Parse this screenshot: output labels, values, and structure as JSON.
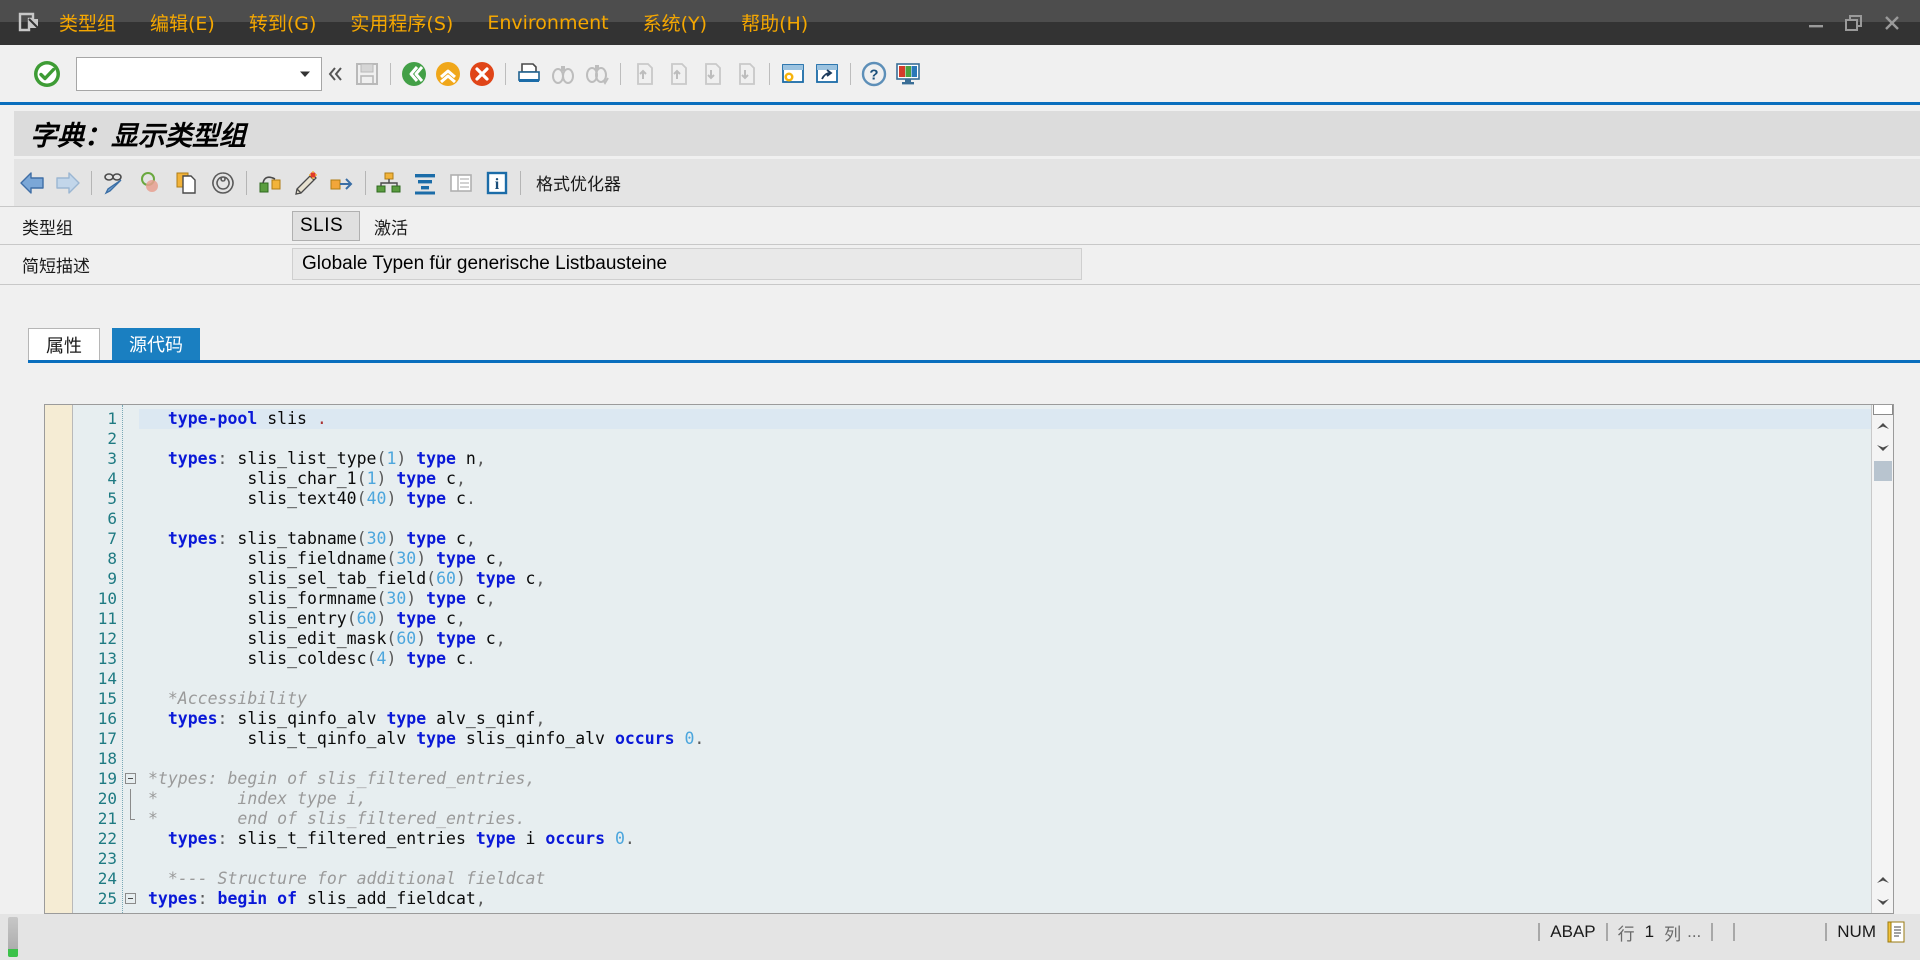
{
  "window": {
    "system_icon": "sap-logo-icon",
    "controls": {
      "minimize": "minimize-icon",
      "restore": "restore-icon",
      "close": "close-icon"
    }
  },
  "menubar": {
    "items": [
      {
        "label": "类型组",
        "accel": ""
      },
      {
        "label": "编辑(E)",
        "accel": "E"
      },
      {
        "label": "转到(G)",
        "accel": "G"
      },
      {
        "label": "实用程序(S)",
        "accel": "S"
      },
      {
        "label": "Environment",
        "accel": ""
      },
      {
        "label": "系统(Y)",
        "accel": "Y"
      },
      {
        "label": "帮助(H)",
        "accel": "H"
      }
    ]
  },
  "toolbar": {
    "ok_button": "green-check-icon",
    "command_value": "",
    "command_placeholder": "",
    "dropdown": "chevron-down-icon",
    "collapse": "double-chevron-left-icon",
    "icons": [
      "save-icon",
      "back-green-icon",
      "exit-yellow-icon",
      "cancel-red-icon",
      "print-icon",
      "find-icon",
      "find-next-icon",
      "first-page-icon",
      "previous-page-icon",
      "next-page-icon",
      "last-page-icon",
      "create-session-icon",
      "create-shortcut-icon",
      "help-icon",
      "customize-layout-icon"
    ]
  },
  "page": {
    "title": "字典：显示类型组"
  },
  "apptoolbar": {
    "icons": [
      "back-arrow-icon",
      "forward-arrow-icon",
      "display-change-icon",
      "check-icon",
      "copy-icon",
      "where-used-icon",
      "activate-icon",
      "pretty-printer-icon",
      "generate-icon",
      "hierarchy-icon",
      "sort-icon",
      "list-icon",
      "info-icon"
    ],
    "format_button": "格式优化器"
  },
  "form": {
    "rows": [
      {
        "label": "类型组",
        "value": "SLIS",
        "status": "激活",
        "kind": "small"
      },
      {
        "label": "简短描述",
        "value": "Globale Typen für generische Listbausteine",
        "status": "",
        "kind": "wide"
      }
    ]
  },
  "tabs": [
    {
      "label": "属性",
      "active": false
    },
    {
      "label": "源代码",
      "active": true
    }
  ],
  "editor": {
    "language": "ABAP",
    "current_line": 1,
    "lines": [
      {
        "n": 1,
        "fold": "none",
        "cur": true,
        "tokens": [
          [
            "ws",
            "  "
          ],
          [
            "kw",
            "type-pool"
          ],
          [
            "id",
            " slis "
          ],
          [
            "dot",
            "."
          ]
        ]
      },
      {
        "n": 2,
        "fold": "none",
        "cur": false,
        "tokens": []
      },
      {
        "n": 3,
        "fold": "none",
        "cur": false,
        "tokens": [
          [
            "ws",
            "  "
          ],
          [
            "kw",
            "types"
          ],
          [
            "punct",
            ": "
          ],
          [
            "id",
            "slis_list_type"
          ],
          [
            "punct",
            "("
          ],
          [
            "num",
            "1"
          ],
          [
            "punct",
            ") "
          ],
          [
            "kw",
            "type"
          ],
          [
            "id",
            " n"
          ],
          [
            "punct",
            ","
          ]
        ]
      },
      {
        "n": 4,
        "fold": "none",
        "cur": false,
        "tokens": [
          [
            "ws",
            "          "
          ],
          [
            "id",
            "slis_char_1"
          ],
          [
            "punct",
            "("
          ],
          [
            "num",
            "1"
          ],
          [
            "punct",
            ") "
          ],
          [
            "kw",
            "type"
          ],
          [
            "id",
            " c"
          ],
          [
            "punct",
            ","
          ]
        ]
      },
      {
        "n": 5,
        "fold": "none",
        "cur": false,
        "tokens": [
          [
            "ws",
            "          "
          ],
          [
            "id",
            "slis_text40"
          ],
          [
            "punct",
            "("
          ],
          [
            "num",
            "40"
          ],
          [
            "punct",
            ") "
          ],
          [
            "kw",
            "type"
          ],
          [
            "id",
            " c"
          ],
          [
            "punct",
            "."
          ]
        ]
      },
      {
        "n": 6,
        "fold": "none",
        "cur": false,
        "tokens": []
      },
      {
        "n": 7,
        "fold": "none",
        "cur": false,
        "tokens": [
          [
            "ws",
            "  "
          ],
          [
            "kw",
            "types"
          ],
          [
            "punct",
            ": "
          ],
          [
            "id",
            "slis_tabname"
          ],
          [
            "punct",
            "("
          ],
          [
            "num",
            "30"
          ],
          [
            "punct",
            ") "
          ],
          [
            "kw",
            "type"
          ],
          [
            "id",
            " c"
          ],
          [
            "punct",
            ","
          ]
        ]
      },
      {
        "n": 8,
        "fold": "none",
        "cur": false,
        "tokens": [
          [
            "ws",
            "          "
          ],
          [
            "id",
            "slis_fieldname"
          ],
          [
            "punct",
            "("
          ],
          [
            "num",
            "30"
          ],
          [
            "punct",
            ") "
          ],
          [
            "kw",
            "type"
          ],
          [
            "id",
            " c"
          ],
          [
            "punct",
            ","
          ]
        ]
      },
      {
        "n": 9,
        "fold": "none",
        "cur": false,
        "tokens": [
          [
            "ws",
            "          "
          ],
          [
            "id",
            "slis_sel_tab_field"
          ],
          [
            "punct",
            "("
          ],
          [
            "num",
            "60"
          ],
          [
            "punct",
            ") "
          ],
          [
            "kw",
            "type"
          ],
          [
            "id",
            " c"
          ],
          [
            "punct",
            ","
          ]
        ]
      },
      {
        "n": 10,
        "fold": "none",
        "cur": false,
        "tokens": [
          [
            "ws",
            "          "
          ],
          [
            "id",
            "slis_formname"
          ],
          [
            "punct",
            "("
          ],
          [
            "num",
            "30"
          ],
          [
            "punct",
            ") "
          ],
          [
            "kw",
            "type"
          ],
          [
            "id",
            " c"
          ],
          [
            "punct",
            ","
          ]
        ]
      },
      {
        "n": 11,
        "fold": "none",
        "cur": false,
        "tokens": [
          [
            "ws",
            "          "
          ],
          [
            "id",
            "slis_entry"
          ],
          [
            "punct",
            "("
          ],
          [
            "num",
            "60"
          ],
          [
            "punct",
            ") "
          ],
          [
            "kw",
            "type"
          ],
          [
            "id",
            " c"
          ],
          [
            "punct",
            ","
          ]
        ]
      },
      {
        "n": 12,
        "fold": "none",
        "cur": false,
        "tokens": [
          [
            "ws",
            "          "
          ],
          [
            "id",
            "slis_edit_mask"
          ],
          [
            "punct",
            "("
          ],
          [
            "num",
            "60"
          ],
          [
            "punct",
            ") "
          ],
          [
            "kw",
            "type"
          ],
          [
            "id",
            " c"
          ],
          [
            "punct",
            ","
          ]
        ]
      },
      {
        "n": 13,
        "fold": "none",
        "cur": false,
        "tokens": [
          [
            "ws",
            "          "
          ],
          [
            "id",
            "slis_coldesc"
          ],
          [
            "punct",
            "("
          ],
          [
            "num",
            "4"
          ],
          [
            "punct",
            ") "
          ],
          [
            "kw",
            "type"
          ],
          [
            "id",
            " c"
          ],
          [
            "punct",
            "."
          ]
        ]
      },
      {
        "n": 14,
        "fold": "none",
        "cur": false,
        "tokens": []
      },
      {
        "n": 15,
        "fold": "none",
        "cur": false,
        "tokens": [
          [
            "ws",
            "  "
          ],
          [
            "cm",
            "*Accessibility"
          ]
        ]
      },
      {
        "n": 16,
        "fold": "none",
        "cur": false,
        "tokens": [
          [
            "ws",
            "  "
          ],
          [
            "kw",
            "types"
          ],
          [
            "punct",
            ": "
          ],
          [
            "id",
            "slis_qinfo_alv "
          ],
          [
            "kw",
            "type"
          ],
          [
            "id",
            " alv_s_qinf"
          ],
          [
            "punct",
            ","
          ]
        ]
      },
      {
        "n": 17,
        "fold": "none",
        "cur": false,
        "tokens": [
          [
            "ws",
            "          "
          ],
          [
            "id",
            "slis_t_qinfo_alv "
          ],
          [
            "kw",
            "type"
          ],
          [
            "id",
            " slis_qinfo_alv "
          ],
          [
            "kw",
            "occurs"
          ],
          [
            "id",
            " "
          ],
          [
            "num",
            "0"
          ],
          [
            "punct",
            "."
          ]
        ]
      },
      {
        "n": 18,
        "fold": "none",
        "cur": false,
        "tokens": []
      },
      {
        "n": 19,
        "fold": "start",
        "cur": false,
        "tokens": [
          [
            "cm",
            "*types: begin of slis_filtered_entries,"
          ]
        ]
      },
      {
        "n": 20,
        "fold": "mid",
        "cur": false,
        "tokens": [
          [
            "cm",
            "*        index type i,"
          ]
        ]
      },
      {
        "n": 21,
        "fold": "end",
        "cur": false,
        "tokens": [
          [
            "cm",
            "*        end of slis_filtered_entries."
          ]
        ]
      },
      {
        "n": 22,
        "fold": "none",
        "cur": false,
        "tokens": [
          [
            "ws",
            "  "
          ],
          [
            "kw",
            "types"
          ],
          [
            "punct",
            ": "
          ],
          [
            "id",
            "slis_t_filtered_entries "
          ],
          [
            "kw",
            "type"
          ],
          [
            "id",
            " i "
          ],
          [
            "kw",
            "occurs"
          ],
          [
            "id",
            " "
          ],
          [
            "num",
            "0"
          ],
          [
            "punct",
            "."
          ]
        ]
      },
      {
        "n": 23,
        "fold": "none",
        "cur": false,
        "tokens": []
      },
      {
        "n": 24,
        "fold": "none",
        "cur": false,
        "tokens": [
          [
            "ws",
            "  "
          ],
          [
            "cm",
            "*--- Structure for additional fieldcat"
          ]
        ]
      },
      {
        "n": 25,
        "fold": "start",
        "cur": false,
        "tokens": [
          [
            "kw",
            "types"
          ],
          [
            "punct",
            ": "
          ],
          [
            "kw",
            "begin"
          ],
          [
            "id",
            " "
          ],
          [
            "kw",
            "of"
          ],
          [
            "id",
            " slis_add_fieldcat"
          ],
          [
            "punct",
            ","
          ]
        ]
      }
    ],
    "scrollbar": {
      "vertical": "vertical-scrollbar"
    }
  },
  "statusbar": {
    "language": "ABAP",
    "line_label": "行",
    "line_value": "1",
    "col_label": "列",
    "col_value": "...",
    "num_lock": "NUM",
    "session_icon": "session-icon"
  }
}
